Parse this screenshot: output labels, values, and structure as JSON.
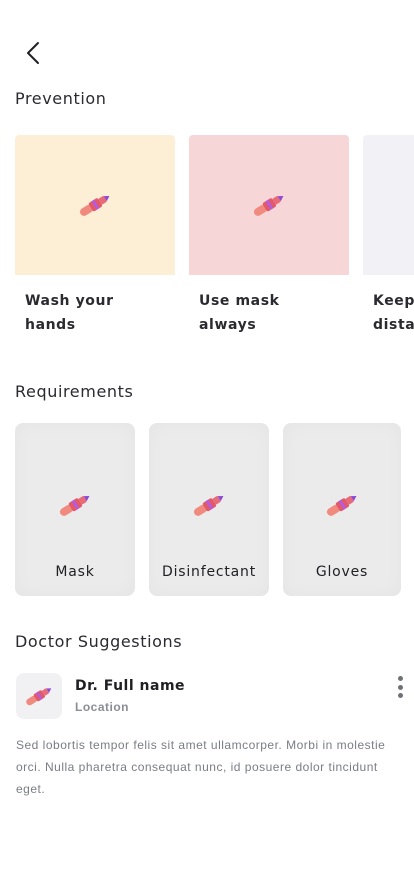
{
  "nav": {
    "back_icon": "chevron-left-icon"
  },
  "sections": {
    "prevention": "Prevention",
    "requirements": "Requirements",
    "doctor_suggestions": "Doctor Suggestions"
  },
  "prevention_cards": [
    {
      "line1": "Wash your",
      "line2": "hands",
      "bg": "#fcefd5",
      "icon": "lipstick-icon"
    },
    {
      "line1": "Use mask",
      "line2": "always",
      "bg": "#f7d6d8",
      "icon": "lipstick-icon"
    },
    {
      "line1": "Keep",
      "line2": "distar",
      "bg": "#f2f2f6",
      "icon": "lipstick-icon"
    }
  ],
  "requirements": [
    {
      "label": "Mask",
      "icon": "lipstick-icon"
    },
    {
      "label": "Disinfectant",
      "icon": "lipstick-icon"
    },
    {
      "label": "Gloves",
      "icon": "lipstick-icon"
    }
  ],
  "doctor": {
    "name": "Dr. Full name",
    "location": "Location",
    "description": "Sed lobortis tempor felis sit amet ullamcorper. Morbi in molestie orci. Nulla pharetra consequat nunc, id posuere dolor tincidunt eget.",
    "menu_icon": "more-vertical-icon"
  }
}
